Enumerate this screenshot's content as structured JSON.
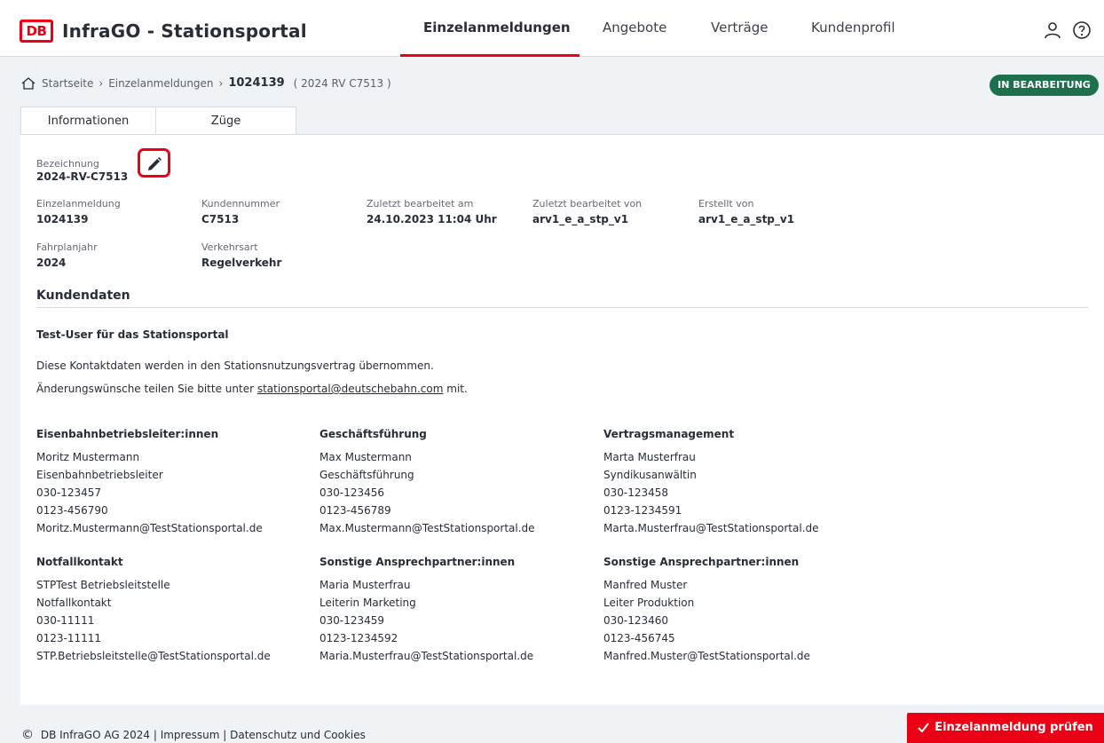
{
  "header": {
    "logo_text": "DB",
    "app_title": "InfraGO - Stationsportal",
    "nav": [
      "Einzelanmeldungen",
      "Angebote",
      "Verträge",
      "Kundenprofil"
    ]
  },
  "breadcrumb": {
    "home": "Startseite",
    "parent": "Einzelanmeldungen",
    "current": "1024139",
    "reference": "( 2024 RV C7513 )"
  },
  "status": "IN BEARBEITUNG",
  "tabs": [
    "Informationen",
    "Züge"
  ],
  "details": {
    "bezeichnung_label": "Bezeichnung",
    "bezeichnung_value": "2024-RV-C7513",
    "fields": [
      {
        "label": "Einzelanmeldung",
        "value": "1024139"
      },
      {
        "label": "Kundennummer",
        "value": "C7513"
      },
      {
        "label": "Zuletzt bearbeitet am",
        "value": "24.10.2023 11:04 Uhr"
      },
      {
        "label": "Zuletzt bearbeitet von",
        "value": "arv1_e_a_stp_v1"
      },
      {
        "label": "Erstellt von",
        "value": "arv1_e_a_stp_v1"
      },
      {
        "label": "Fahrplanjahr",
        "value": "2024"
      },
      {
        "label": "Verkehrsart",
        "value": "Regelverkehr"
      }
    ]
  },
  "kundendaten": {
    "title": "Kundendaten",
    "customer_name": "Test-User für das Stationsportal",
    "info_line1": "Diese Kontaktdaten werden in den Stationsnutzungsvertrag übernommen.",
    "info_line2_before": "Änderungswünsche teilen Sie bitte unter ",
    "info_email": "stationsportal@deutschebahn.com",
    "info_line2_after": " mit.",
    "contacts": [
      {
        "title": "Eisenbahnbetriebsleiter:innen",
        "lines": [
          "Moritz Mustermann",
          "Eisenbahnbetriebsleiter",
          "030-123457",
          "0123-456790",
          "Moritz.Mustermann@TestStationsportal.de"
        ]
      },
      {
        "title": "Geschäftsführung",
        "lines": [
          "Max Mustermann",
          "Geschäftsführung",
          "030-123456",
          "0123-456789",
          "Max.Mustermann@TestStationsportal.de"
        ]
      },
      {
        "title": "Vertragsmanagement",
        "lines": [
          "Marta Musterfrau",
          "Syndikusanwältin",
          "030-123458",
          "0123-1234591",
          "Marta.Musterfrau@TestStationsportal.de"
        ]
      },
      {
        "title": "Notfallkontakt",
        "lines": [
          "STPTest Betriebsleitstelle",
          "Notfallkontakt",
          "030-11111",
          "0123-11111",
          "STP.Betriebsleitstelle@TestStationsportal.de"
        ]
      },
      {
        "title": "Sonstige Ansprechpartner:innen",
        "lines": [
          "Maria Musterfrau",
          "Leiterin Marketing",
          "030-123459",
          "0123-1234592",
          "Maria.Musterfrau@TestStationsportal.de"
        ]
      },
      {
        "title": "Sonstige Ansprechpartner:innen",
        "lines": [
          "Manfred Muster",
          "Leiter Produktion",
          "030-123460",
          "0123-456745",
          "Manfred.Muster@TestStationsportal.de"
        ]
      }
    ]
  },
  "footer": {
    "copyright_symbol": "©",
    "company": "DB InfraGO AG 2024",
    "links": [
      "Impressum",
      "Datenschutz und Cookies"
    ],
    "separator": "|"
  },
  "actions": {
    "check_button": "Einzelanmeldung prüfen",
    "check_icon": "checkmark-icon"
  },
  "colors": {
    "brand_red": "#ec0016",
    "status_green": "#1e6f4e"
  }
}
